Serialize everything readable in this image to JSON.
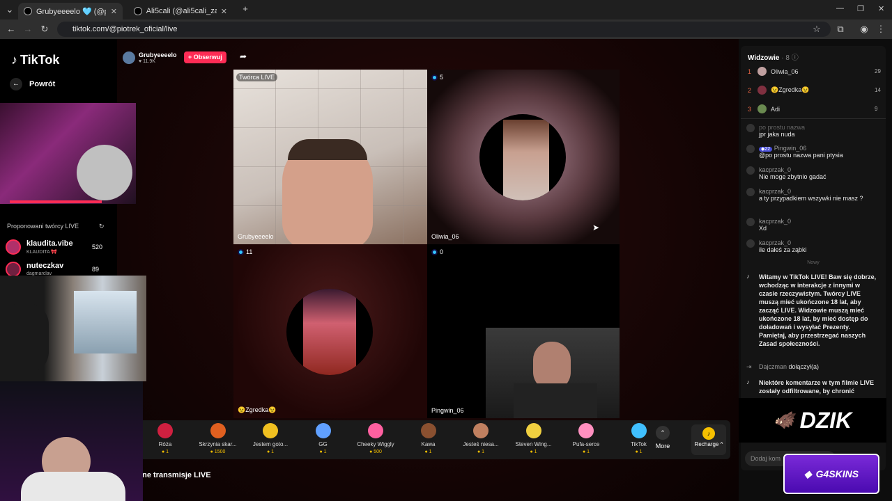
{
  "browser": {
    "tabs": [
      {
        "title": "Grubyeeeelo 🩵 (@piotrek_",
        "active": true
      },
      {
        "title": "Ali5cali (@ali5cali_zapasowe_) |",
        "active": false
      }
    ],
    "url": "tiktok.com/@piotrek_oficial/live"
  },
  "nav": {
    "logo": "TikTok",
    "back_label": "Powrót",
    "suggested_header": "Proponowani twórcy LIVE",
    "suggested": [
      {
        "name": "klaudita.vibe",
        "sub": "KLAUDITA 🎀",
        "count": "520"
      },
      {
        "name": "nuteczkav",
        "sub": "dagmarclav",
        "count": "89"
      }
    ]
  },
  "host": {
    "name": "Grubyeeeelo",
    "likes": "11.9K",
    "follow_label": "+ Obserwuj"
  },
  "tiles": {
    "creator_badge": "Twórca LIVE",
    "t1_name": "Grubyeeeelo",
    "t2_count": "5",
    "t2_name": "Oliwia_06",
    "t3_count": "11",
    "t3_name": "😉Zgredka😉",
    "t4_count": "0",
    "t4_name": "Pingwin_06"
  },
  "gifts": [
    {
      "name": "Róża",
      "price": "1"
    },
    {
      "name": "Skrzynia skar...",
      "price": "1500"
    },
    {
      "name": "Jestem goto...",
      "price": "1"
    },
    {
      "name": "GG",
      "price": "1"
    },
    {
      "name": "Cheeky Wiggly",
      "price": "500"
    },
    {
      "name": "Kawa",
      "price": "1"
    },
    {
      "name": "Jesteś niesa...",
      "price": "1"
    },
    {
      "name": "Steven Wing...",
      "price": "1"
    },
    {
      "name": "Pufa-serce",
      "price": "1"
    },
    {
      "name": "TikTok",
      "price": "1"
    }
  ],
  "gifts_more": "More",
  "recharge": "Recharge ^",
  "footer_text": "ane transmisje LIVE",
  "viewers": {
    "header": "Widzowie",
    "count": "8",
    "list": [
      {
        "rank": "1",
        "name": "Oliwia_06",
        "score": "29"
      },
      {
        "rank": "2",
        "name": "😉Zgredka😉",
        "score": "14"
      },
      {
        "rank": "3",
        "name": "Adi",
        "score": "9"
      }
    ]
  },
  "chat": {
    "c0_user": "po prostu nazwa",
    "c0_text": "jpr jaka nuda",
    "c1_badge": "22",
    "c1_user": "Pingwin_06",
    "c1_text": "@po prostu nazwa pani ptysia",
    "c2_user": "kacprzak_0",
    "c2_text": "Nie moge zbytnio gadać",
    "c3_user": "kacprzak_0",
    "c3_text": "a ty przypadkiem wszywki nie masz ?",
    "c4_user": "kacprzak_0",
    "c4_text": "Xd",
    "c5_user": "kacprzak_0",
    "c5_text": "ile dałeś za ząbki",
    "new_divider": "Nowy",
    "welcome": "Witamy w TikTok LIVE! Baw się dobrze, wchodząc w interakcje z innymi w czasie rzeczywistym. Twórcy LIVE muszą mieć ukończone 18 lat, aby zacząć LIVE. Widzowie muszą mieć ukończone 18 lat, by mieć dostęp do doładowań i wysyłać Prezenty. Pamiętaj, aby przestrzegać naszych Zasad społeczności.",
    "join_user": "Dajczman",
    "join_text": "dołączył(a)",
    "filtered": "Niektóre komentarze w tym filmie LIVE zostały odfiltrowane, by chronić",
    "input_placeholder": "Dodaj kom"
  },
  "sponsors": {
    "dzik": "DZIK",
    "g4": "G4SKINS"
  },
  "colors": {
    "accent": "#fe2c55",
    "gold": "#f6c000",
    "cyan": "#33c5ff"
  }
}
